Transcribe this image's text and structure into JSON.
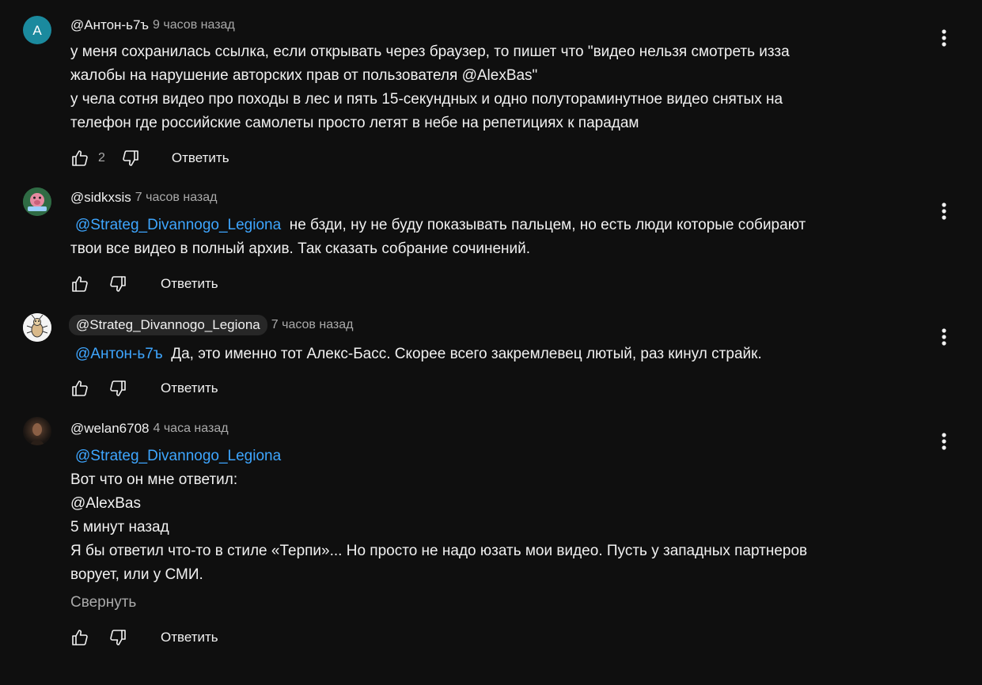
{
  "comments": [
    {
      "author": "@Антон-ь7ъ",
      "time": "9 часов назад",
      "avatar_letter": "А",
      "avatar_color": "#1b8a9e",
      "text": "у меня сохранилась ссылка, если открывать через браузер, то пишет что \"видео нельзя смотреть изза\nжалобы на нарушение авторских прав от пользователя @AlexBas\"\nу чела сотня видео про походы в лес и пять 15-секундных и одно полутораминутное видео снятых на\nтелефон где российские самолеты просто летят в небе на репетициях к парадам",
      "likes": "2",
      "reply_label": "Ответить"
    },
    {
      "author": "@sidkxsis",
      "time": "7 часов назад",
      "avatar_icon": "pig-avatar",
      "mention": "@Strateg_Divannogo_Legiona",
      "text": "не бзди, ну не буду показывать пальцем, но есть люди которые собирают\nтвои все видео в полный архив. Так сказать собрание сочинений.",
      "reply_label": "Ответить"
    },
    {
      "author": "@Strateg_Divannogo_Legiona",
      "time": "7 часов назад",
      "avatar_icon": "bug-avatar",
      "mention": "@Антон-ь7ъ",
      "text": "Да, это именно тот Алекс-Басс. Скорее всего закремлевец лютый, раз кинул страйк.",
      "reply_label": "Ответить"
    },
    {
      "author": "@welan6708",
      "time": "4 часа назад",
      "avatar_icon": "photo-avatar",
      "mention": "@Strateg_Divannogo_Legiona",
      "text": "Вот что он мне ответил:\n@AlexBas\n5 минут назад\nЯ бы ответил что-то в стиле «Терпи»... Но просто не надо юзать мои видео. Пусть у западных партнеров\nворует, или у СМИ.",
      "collapse_label": "Свернуть",
      "reply_label": "Ответить"
    }
  ],
  "colors": {
    "background": "#0f0f0f",
    "text": "#f1f1f1",
    "secondary": "#aaaaaa",
    "mention": "#3ea6ff",
    "chip": "#272727"
  }
}
